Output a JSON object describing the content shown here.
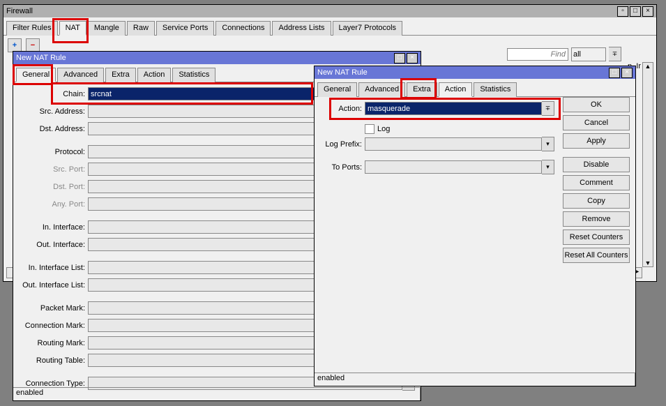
{
  "firewall": {
    "title": "Firewall",
    "tabs": [
      "Filter Rules",
      "NAT",
      "Mangle",
      "Raw",
      "Service Ports",
      "Connections",
      "Address Lists",
      "Layer7 Protocols"
    ],
    "active_tab": "NAT",
    "find_placeholder": "Find",
    "filter_value": "all",
    "ini_label": "n. Ir",
    "scroll_up": "▲",
    "scroll_down": "▼",
    "scroll_right": "►"
  },
  "left": {
    "title": "New NAT Rule",
    "tabs": [
      "General",
      "Advanced",
      "Extra",
      "Action",
      "Statistics"
    ],
    "active_tab": "General",
    "fields": {
      "chain": {
        "label": "Chain:",
        "value": "srcnat"
      },
      "src_addr": {
        "label": "Src. Address:",
        "value": ""
      },
      "dst_addr": {
        "label": "Dst. Address:",
        "value": ""
      },
      "protocol": {
        "label": "Protocol:",
        "value": ""
      },
      "src_port": {
        "label": "Src. Port:",
        "value": ""
      },
      "dst_port": {
        "label": "Dst. Port:",
        "value": ""
      },
      "any_port": {
        "label": "Any. Port:",
        "value": ""
      },
      "in_if": {
        "label": "In. Interface:",
        "value": ""
      },
      "out_if": {
        "label": "Out. Interface:",
        "value": ""
      },
      "in_if_list": {
        "label": "In. Interface List:",
        "value": ""
      },
      "out_if_list": {
        "label": "Out. Interface List:",
        "value": ""
      },
      "pkt_mark": {
        "label": "Packet Mark:",
        "value": ""
      },
      "conn_mark": {
        "label": "Connection Mark:",
        "value": ""
      },
      "route_mark": {
        "label": "Routing Mark:",
        "value": ""
      },
      "route_table": {
        "label": "Routing Table:",
        "value": ""
      },
      "conn_type": {
        "label": "Connection Type:",
        "value": ""
      }
    },
    "status": "enabled"
  },
  "right": {
    "title": "New NAT Rule",
    "tabs": [
      "General",
      "Advanced",
      "Extra",
      "Action",
      "Statistics"
    ],
    "active_tab": "Action",
    "fields": {
      "action": {
        "label": "Action:",
        "value": "masquerade"
      },
      "log": {
        "label": "Log"
      },
      "log_prefix": {
        "label": "Log Prefix:",
        "value": ""
      },
      "to_ports": {
        "label": "To Ports:",
        "value": ""
      }
    },
    "buttons": [
      "OK",
      "Cancel",
      "Apply",
      "Disable",
      "Comment",
      "Copy",
      "Remove",
      "Reset Counters",
      "Reset All Counters"
    ],
    "status": "enabled"
  }
}
